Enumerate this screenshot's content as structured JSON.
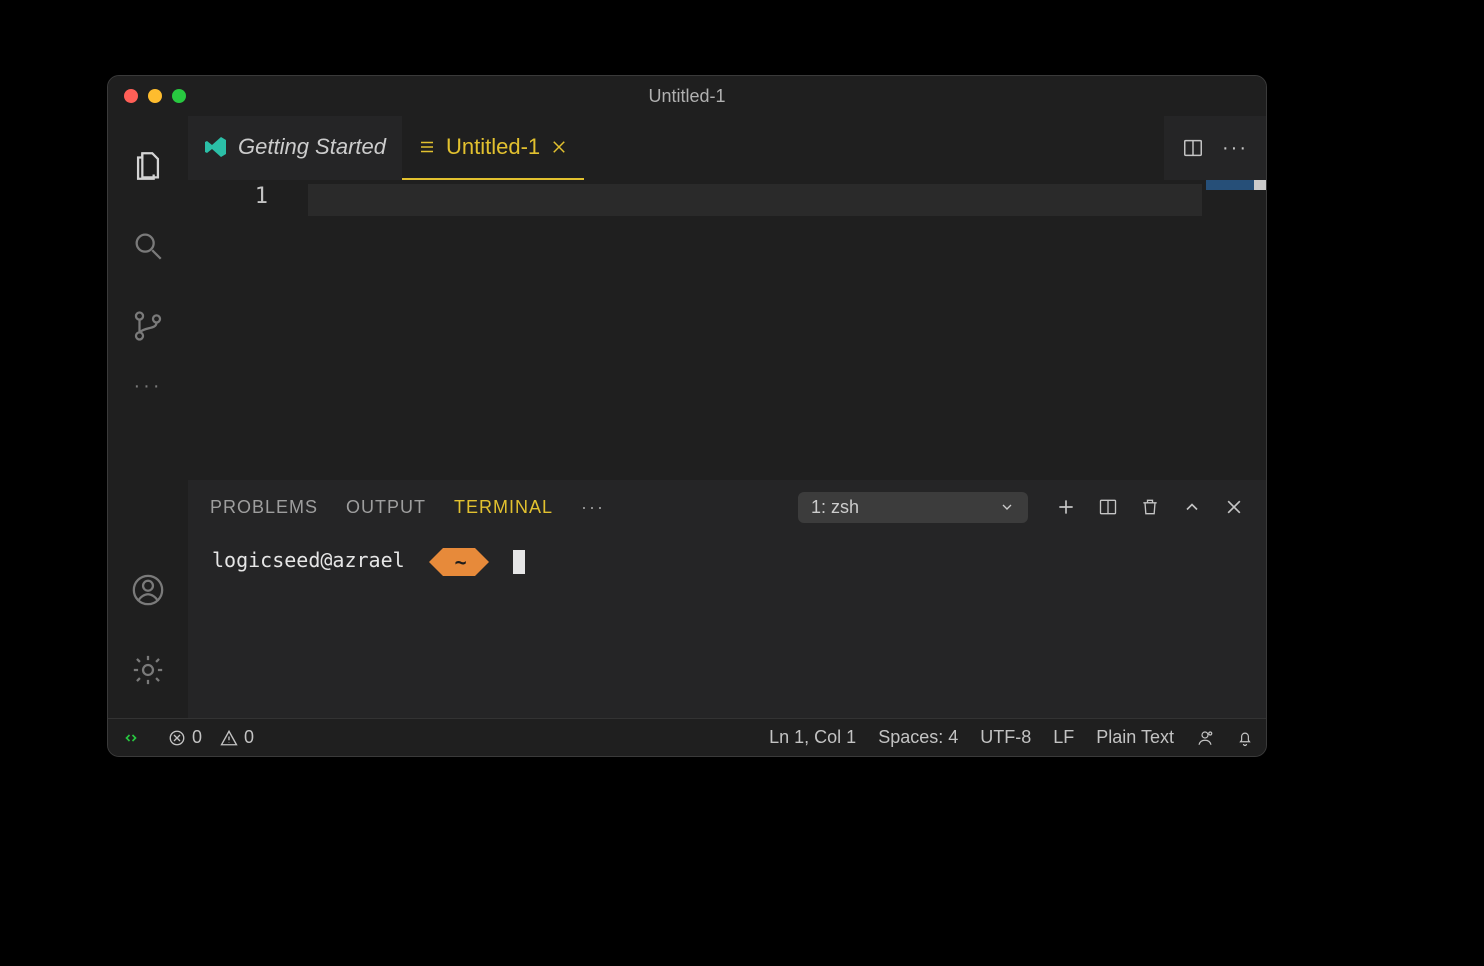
{
  "window": {
    "title": "Untitled-1"
  },
  "tabs": {
    "getting_started": {
      "label": "Getting Started"
    },
    "untitled": {
      "label": "Untitled-1"
    }
  },
  "editor": {
    "line_number_1": "1"
  },
  "panel": {
    "tabs": {
      "problems": "PROBLEMS",
      "output": "OUTPUT",
      "terminal": "TERMINAL"
    },
    "terminal_select": "1: zsh"
  },
  "terminal": {
    "prompt_user": "logicseed@azrael",
    "prompt_path": "~"
  },
  "status": {
    "errors": "0",
    "warnings": "0",
    "position": "Ln 1, Col 1",
    "indent": "Spaces: 4",
    "encoding": "UTF-8",
    "eol": "LF",
    "language": "Plain Text"
  }
}
